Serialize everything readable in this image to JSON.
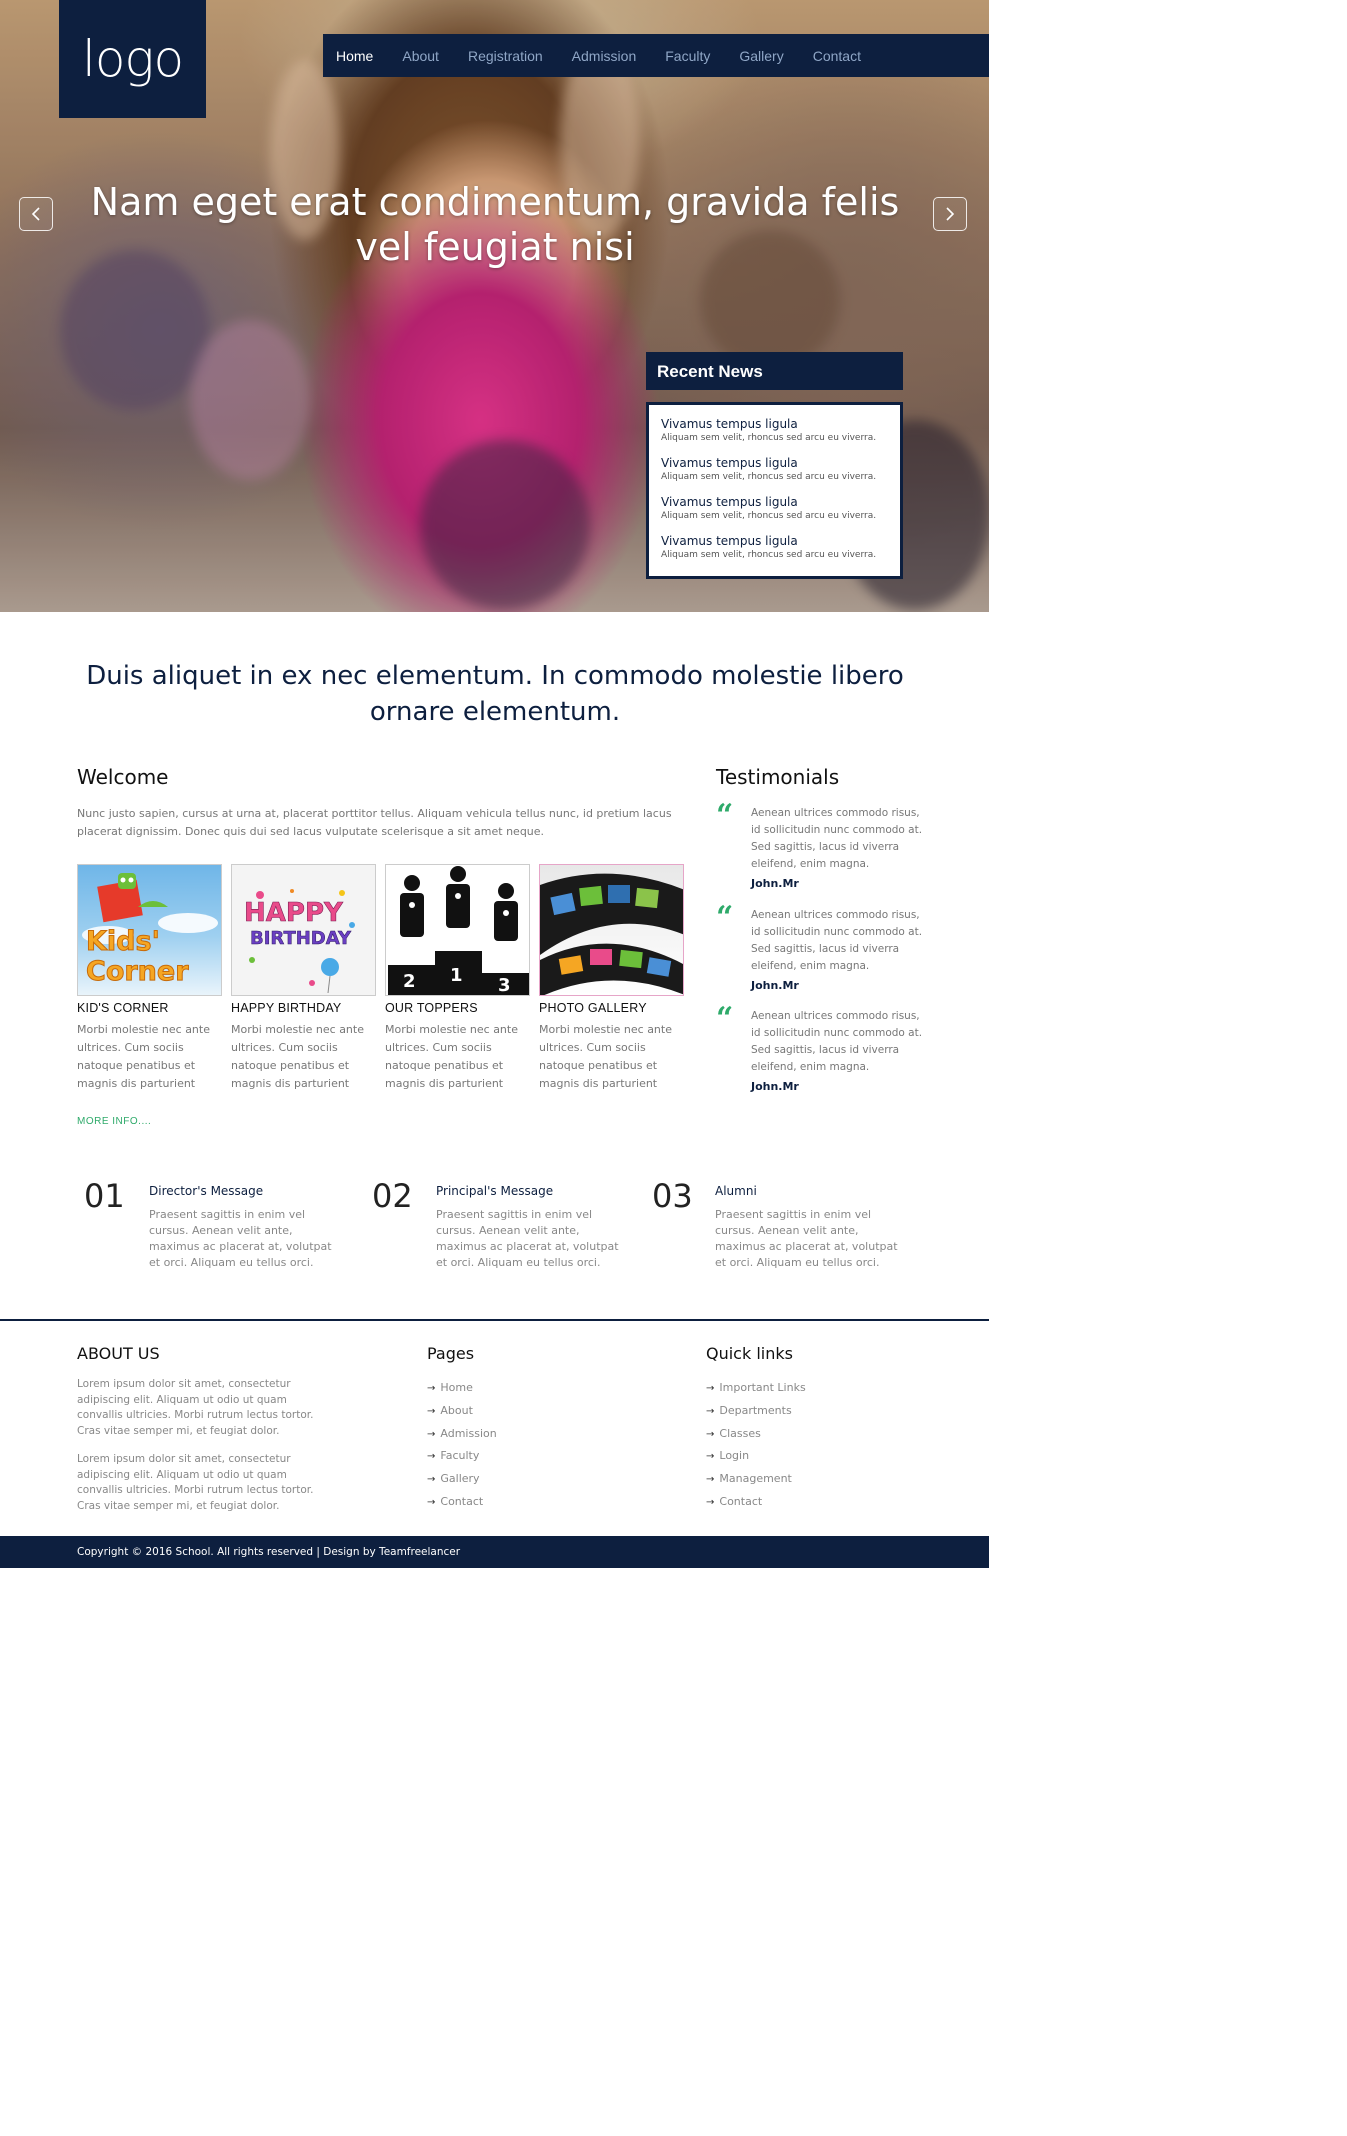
{
  "header": {
    "logo_text": "logo",
    "nav": [
      {
        "label": "Home",
        "active": true
      },
      {
        "label": "About",
        "active": false
      },
      {
        "label": "Registration",
        "active": false
      },
      {
        "label": "Admission",
        "active": false
      },
      {
        "label": "Faculty",
        "active": false
      },
      {
        "label": "Gallery",
        "active": false
      },
      {
        "label": "Contact",
        "active": false
      }
    ]
  },
  "hero": {
    "title": "Nam eget erat condimentum, gravida felis vel feugiat nisi",
    "prev_icon": "chevron-left-icon",
    "next_icon": "chevron-right-icon"
  },
  "recent_news": {
    "heading": "Recent News",
    "items": [
      {
        "title": "Vivamus tempus ligula",
        "text": "Aliquam sem velit, rhoncus sed arcu eu viverra."
      },
      {
        "title": "Vivamus tempus ligula",
        "text": "Aliquam sem velit, rhoncus sed arcu eu viverra."
      },
      {
        "title": "Vivamus tempus ligula",
        "text": "Aliquam sem velit, rhoncus sed arcu eu viverra."
      },
      {
        "title": "Vivamus tempus ligula",
        "text": "Aliquam sem velit, rhoncus sed arcu eu viverra."
      }
    ]
  },
  "intro": {
    "headline": "Duis aliquet in ex nec elementum. In commodo molestie libero ornare elementum."
  },
  "welcome": {
    "heading": "Welcome",
    "text": "Nunc justo sapien, cursus at urna at, placerat porttitor tellus. Aliquam vehicula tellus nunc, id pretium lacus placerat dignissim. Donec quis dui sed lacus vulputate scelerisque a sit amet neque.",
    "cards": [
      {
        "title": "KID'S CORNER",
        "text": "Morbi molestie nec ante ultrices. Cum sociis natoque penatibus et magnis dis parturient",
        "image_text": [
          "Kids'",
          "Corner"
        ]
      },
      {
        "title": "HAPPY BIRTHDAY",
        "text": "Morbi molestie nec ante ultrices. Cum sociis natoque penatibus et magnis dis parturient",
        "image_text": [
          "HAPPY",
          "BIRTHDAY"
        ]
      },
      {
        "title": "OUR TOPPERS",
        "text": "Morbi molestie nec ante ultrices. Cum sociis natoque penatibus et magnis dis parturient",
        "image_text": [
          "2",
          "1",
          "3"
        ]
      },
      {
        "title": "PHOTO GALLERY",
        "text": "Morbi molestie nec ante ultrices. Cum sociis natoque penatibus et magnis dis parturient",
        "image_text": []
      }
    ],
    "more_info": "MORE INFO...."
  },
  "testimonials": {
    "heading": "Testimonials",
    "quote_icon": "quote-icon",
    "items": [
      {
        "text": "Aenean ultrices commodo risus, id sollicitudin nunc commodo at. Sed sagittis, lacus id viverra eleifend, enim magna.",
        "author": "John.Mr"
      },
      {
        "text": "Aenean ultrices commodo risus, id sollicitudin nunc commodo at. Sed sagittis, lacus id viverra eleifend, enim magna.",
        "author": "John.Mr"
      },
      {
        "text": "Aenean ultrices commodo risus, id sollicitudin nunc commodo at. Sed sagittis, lacus id viverra eleifend, enim magna.",
        "author": "John.Mr"
      }
    ]
  },
  "messages": [
    {
      "num": "01",
      "title": "Director's Message",
      "text": "Praesent sagittis in enim vel cursus. Aenean velit ante, maximus ac placerat at, volutpat et orci. Aliquam eu tellus orci."
    },
    {
      "num": "02",
      "title": "Principal's Message",
      "text": "Praesent sagittis in enim vel cursus. Aenean velit ante, maximus ac placerat at, volutpat et orci. Aliquam eu tellus orci."
    },
    {
      "num": "03",
      "title": "Alumni",
      "text": "Praesent sagittis in enim vel cursus. Aenean velit ante, maximus ac placerat at, volutpat et orci. Aliquam eu tellus orci."
    }
  ],
  "footer": {
    "about_heading": "ABOUT US",
    "about_paragraphs": [
      "Lorem ipsum dolor sit amet, consectetur adipiscing elit. Aliquam ut odio ut quam convallis ultricies. Morbi rutrum lectus tortor. Cras vitae semper mi, et feugiat dolor.",
      "Lorem ipsum dolor sit amet, consectetur adipiscing elit. Aliquam ut odio ut quam convallis ultricies. Morbi rutrum lectus tortor. Cras vitae semper mi, et feugiat dolor."
    ],
    "pages_heading": "Pages",
    "pages": [
      "Home",
      "About",
      "Admission",
      "Faculty",
      "Gallery",
      "Contact"
    ],
    "quick_heading": "Quick links",
    "quick_links": [
      "Important Links",
      "Departments",
      "Classes",
      "Login",
      "Management",
      "Contact"
    ],
    "arrow_glyph": "→",
    "copyright": "Copyright © 2016 School. All rights reserved | Design by Teamfreelancer"
  },
  "colors": {
    "navy": "#0d1f3f",
    "nav_inactive": "#8fa6c6",
    "accent_green": "#2eaa6a"
  }
}
